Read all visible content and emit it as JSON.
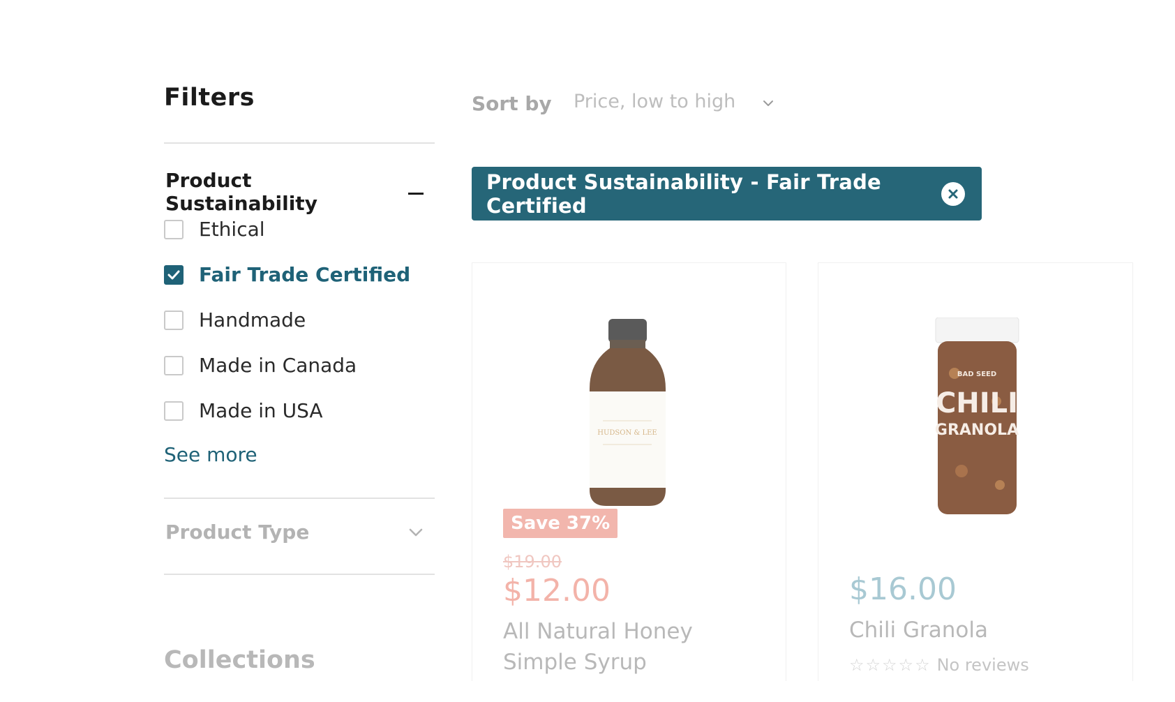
{
  "sidebar": {
    "title": "Filters",
    "sustainability": {
      "label": "Product Sustainability",
      "options": [
        {
          "label": "Ethical",
          "checked": false
        },
        {
          "label": "Fair Trade Certified",
          "checked": true
        },
        {
          "label": "Handmade",
          "checked": false
        },
        {
          "label": "Made in Canada",
          "checked": false
        },
        {
          "label": "Made in USA",
          "checked": false
        }
      ],
      "see_more": "See more"
    },
    "product_type": {
      "label": "Product Type"
    },
    "collections": "Collections"
  },
  "sort": {
    "label": "Sort by",
    "value": "Price, low to high"
  },
  "active_filter": {
    "label": "Product Sustainability - Fair Trade Certified"
  },
  "products": [
    {
      "badge": "Save 37%",
      "old_price": "$19.00",
      "price": "$12.00",
      "name": "All Natural Honey Simple Syrup",
      "bottle_label": "HUDSON & LEE"
    },
    {
      "price": "$16.00",
      "name": "Chili Granola",
      "rating_text": "No reviews",
      "jar_brand": "BAD SEED",
      "jar_title": "CHILI",
      "jar_subtitle": "GRANOLA"
    }
  ],
  "colors": {
    "accent": "#266678",
    "sale": "#f3b3a9"
  }
}
